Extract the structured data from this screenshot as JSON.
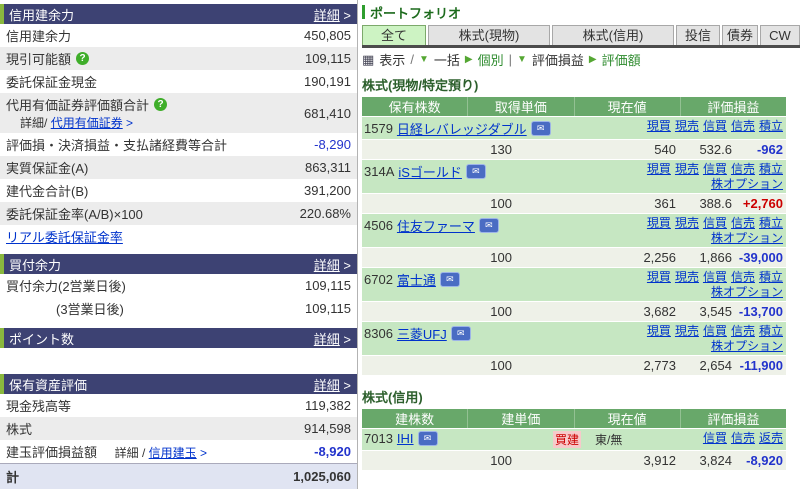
{
  "colors": {
    "header_navy": "#3d4273",
    "header_accent_green": "#8ab83e",
    "table_header_green": "#68a86a",
    "name_row_green": "#c6e7c2",
    "loss_blue": "#2233cc",
    "profit_red": "#cc0000",
    "link_blue": "#0033cc",
    "active_tab_green": "#cdf3c3"
  },
  "left": {
    "margin": {
      "title": "信用建余力",
      "detail": "詳細",
      "detail_arrow": ">",
      "rows": [
        {
          "label": "信用建余力",
          "value": "450,805"
        },
        {
          "label": "現引可能額",
          "value": "109,115"
        },
        {
          "label": "委託保証金現金",
          "value": "190,191"
        },
        {
          "label": "代用有価証券評価額合計",
          "value": "681,410",
          "sub_prefix": "詳細/",
          "sub_link": "代用有価証券",
          "sub_arrow": ">"
        },
        {
          "label": "評価損・決済損益・支払諸経費等合計",
          "value": "-8,290"
        },
        {
          "label": "実質保証金(A)",
          "value": "863,311"
        },
        {
          "label": "建代金合計(B)",
          "value": "391,200"
        },
        {
          "label": "委託保証金率(A/B)×100",
          "value": "220.68%"
        }
      ],
      "realtime_link": "リアル委託保証金率"
    },
    "buying_power": {
      "title": "買付余力",
      "detail": "詳細",
      "rows": [
        {
          "label": "買付余力(2営業日後)",
          "value": "109,115"
        },
        {
          "label": "(3営業日後)",
          "value": "109,115"
        }
      ]
    },
    "points": {
      "title": "ポイント数",
      "detail": "詳細"
    },
    "assets": {
      "title": "保有資産評価",
      "detail": "詳細",
      "rows": [
        {
          "label": "現金残高等",
          "value": "119,382"
        },
        {
          "label": "株式",
          "value": "914,598"
        },
        {
          "label": "建玉評価損益額",
          "value": "-8,920",
          "sub_prefix": "詳細 /",
          "sub_link": "信用建玉",
          "sub_arrow": ">"
        }
      ],
      "total_label": "計",
      "total_value": "1,025,060"
    },
    "help_glyph": "?"
  },
  "portfolio": {
    "title": "ポートフォリオ",
    "tabs": [
      {
        "label": "全て",
        "active": true
      },
      {
        "label": "株式(現物)",
        "active": false
      },
      {
        "label": "株式(信用)",
        "active": false
      },
      {
        "label": "投信",
        "active": false
      },
      {
        "label": "債券",
        "active": false
      },
      {
        "label": "CW",
        "active": false
      }
    ],
    "toolbar": {
      "display_label": "表示",
      "slash": "/",
      "batch_label": "一括",
      "individual_label": "個別",
      "pipe": "|",
      "pl_label": "評価損益",
      "valuation_label": "評価額",
      "tri_down": "▼",
      "tri_right": "▶",
      "grid_glyph": "▦"
    },
    "mail_glyph": "✉",
    "sections": [
      {
        "title": "株式(現物/特定預り)",
        "headers": [
          "保有株数",
          "取得単価",
          "現在値",
          "評価損益"
        ],
        "rows": [
          {
            "code": "1579",
            "name": "日経レバレッジダブル",
            "link_lines": [
              [
                "現買",
                "現売",
                "信買",
                "信売",
                "積立"
              ]
            ],
            "values": [
              "130",
              "540",
              "532.6"
            ],
            "pl": "-962",
            "pl_type": "loss"
          },
          {
            "code": "314A",
            "name": "iSゴールド",
            "link_lines": [
              [
                "現買",
                "現売",
                "信買",
                "信売",
                "積立"
              ],
              [
                "株オプション"
              ]
            ],
            "values": [
              "100",
              "361",
              "388.6"
            ],
            "pl": "+2,760",
            "pl_type": "profit"
          },
          {
            "code": "4506",
            "name": "住友ファーマ",
            "link_lines": [
              [
                "現買",
                "現売",
                "信買",
                "信売",
                "積立"
              ],
              [
                "株オプション"
              ]
            ],
            "values": [
              "100",
              "2,256",
              "1,866"
            ],
            "pl": "-39,000",
            "pl_type": "loss"
          },
          {
            "code": "6702",
            "name": "富士通",
            "link_lines": [
              [
                "現買",
                "現売",
                "信買",
                "信売",
                "積立"
              ],
              [
                "株オプション"
              ]
            ],
            "values": [
              "100",
              "3,682",
              "3,545"
            ],
            "pl": "-13,700",
            "pl_type": "loss"
          },
          {
            "code": "8306",
            "name": "三菱UFJ",
            "link_lines": [
              [
                "現買",
                "現売",
                "信買",
                "信売",
                "積立"
              ],
              [
                "株オプション"
              ]
            ],
            "values": [
              "100",
              "2,773",
              "2,654"
            ],
            "pl": "-11,900",
            "pl_type": "loss"
          }
        ]
      },
      {
        "title": "株式(信用)",
        "headers": [
          "建株数",
          "建単価",
          "現在値",
          "評価損益"
        ],
        "rows": [
          {
            "code": "7013",
            "name": "IHI",
            "badge": "買建",
            "market": "東/無",
            "link_lines": [
              [
                "信買",
                "信売",
                "返売"
              ]
            ],
            "values": [
              "100",
              "3,912",
              "3,824"
            ],
            "pl": "-8,920",
            "pl_type": "loss"
          }
        ]
      }
    ]
  }
}
